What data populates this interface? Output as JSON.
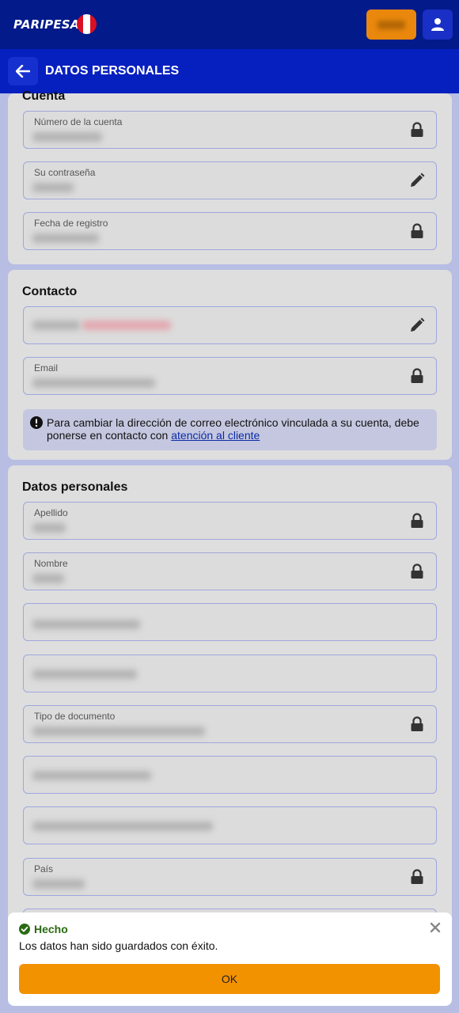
{
  "header": {
    "logo_text": "PARIPESA",
    "flag_colors": [
      "#d91023",
      "#ffffff",
      "#d91023"
    ],
    "accent_color": "#021a8a"
  },
  "subheader": {
    "title": "DATOS PERSONALES"
  },
  "sections": {
    "account": {
      "title": "Cuenta",
      "fields": [
        {
          "label": "Número de la cuenta",
          "icon": "lock-icon"
        },
        {
          "label": "Su contraseña",
          "icon": "pencil-icon"
        },
        {
          "label": "Fecha de registro",
          "icon": "lock-icon"
        }
      ]
    },
    "contact": {
      "title": "Contacto",
      "fields": [
        {
          "label": "",
          "icon": "pencil-icon"
        },
        {
          "label": "Email",
          "icon": "lock-icon"
        }
      ],
      "notice": {
        "text": "Para cambiar la dirección de correo electrónico vinculada a su cuenta, debe ponerse en contacto con ",
        "link": "atención al cliente"
      }
    },
    "personal": {
      "title": "Datos personales",
      "fields": [
        {
          "label": "Apellido",
          "icon": "lock-icon"
        },
        {
          "label": "Nombre",
          "icon": "lock-icon"
        },
        {
          "label": "",
          "icon": ""
        },
        {
          "label": "",
          "icon": ""
        },
        {
          "label": "Tipo de documento",
          "icon": "lock-icon"
        },
        {
          "label": "",
          "icon": ""
        },
        {
          "label": "",
          "icon": ""
        },
        {
          "label": "País",
          "icon": "lock-icon"
        }
      ]
    }
  },
  "toast": {
    "title": "Hecho",
    "message": "Los datos han sido guardados con éxito.",
    "ok_label": "OK",
    "success_color": "#2a6a12",
    "button_color": "#f39200"
  }
}
